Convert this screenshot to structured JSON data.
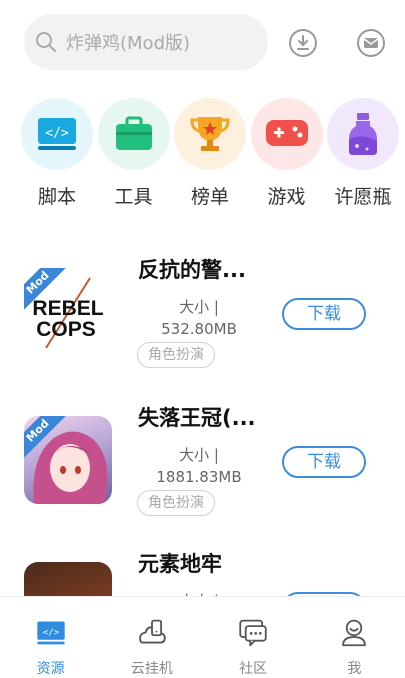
{
  "search": {
    "placeholder": "炸弹鸡(Mod版)"
  },
  "header_icons": [
    "download-icon",
    "mail-icon"
  ],
  "categories": [
    {
      "label": "脚本",
      "icon": "code-screen-icon",
      "bg": "#e4f6fb"
    },
    {
      "label": "工具",
      "icon": "toolbox-icon",
      "bg": "#e6f7ef"
    },
    {
      "label": "榜单",
      "icon": "trophy-icon",
      "bg": "#fdf0df"
    },
    {
      "label": "游戏",
      "icon": "gamepad-icon",
      "bg": "#fde7e6"
    },
    {
      "label": "许愿瓶",
      "icon": "bottle-icon",
      "bg": "#f1e8fb"
    }
  ],
  "apps": [
    {
      "title": "反抗的警...",
      "size_line1": "大小 |",
      "size_line2": "532.80MB",
      "tag": "角色扮演",
      "button": "下载",
      "badge": "Mod",
      "logo_text_1": "REBEL",
      "logo_text_2": "COPS"
    },
    {
      "title": "失落王冠(...",
      "size_line1": "大小 |",
      "size_line2": "1881.83MB",
      "tag": "角色扮演",
      "button": "下载",
      "badge": "Mod"
    },
    {
      "title": "元素地牢",
      "size_line1": "大小 |",
      "button": "下载"
    }
  ],
  "nav": [
    {
      "label": "资源",
      "icon": "resource-icon",
      "active": true
    },
    {
      "label": "云挂机",
      "icon": "cloud-device-icon",
      "active": false
    },
    {
      "label": "社区",
      "icon": "community-chat-icon",
      "active": false
    },
    {
      "label": "我",
      "icon": "profile-icon",
      "active": false
    }
  ],
  "colors": {
    "accent": "#2f8ce0",
    "badge": "#3a86d8"
  }
}
